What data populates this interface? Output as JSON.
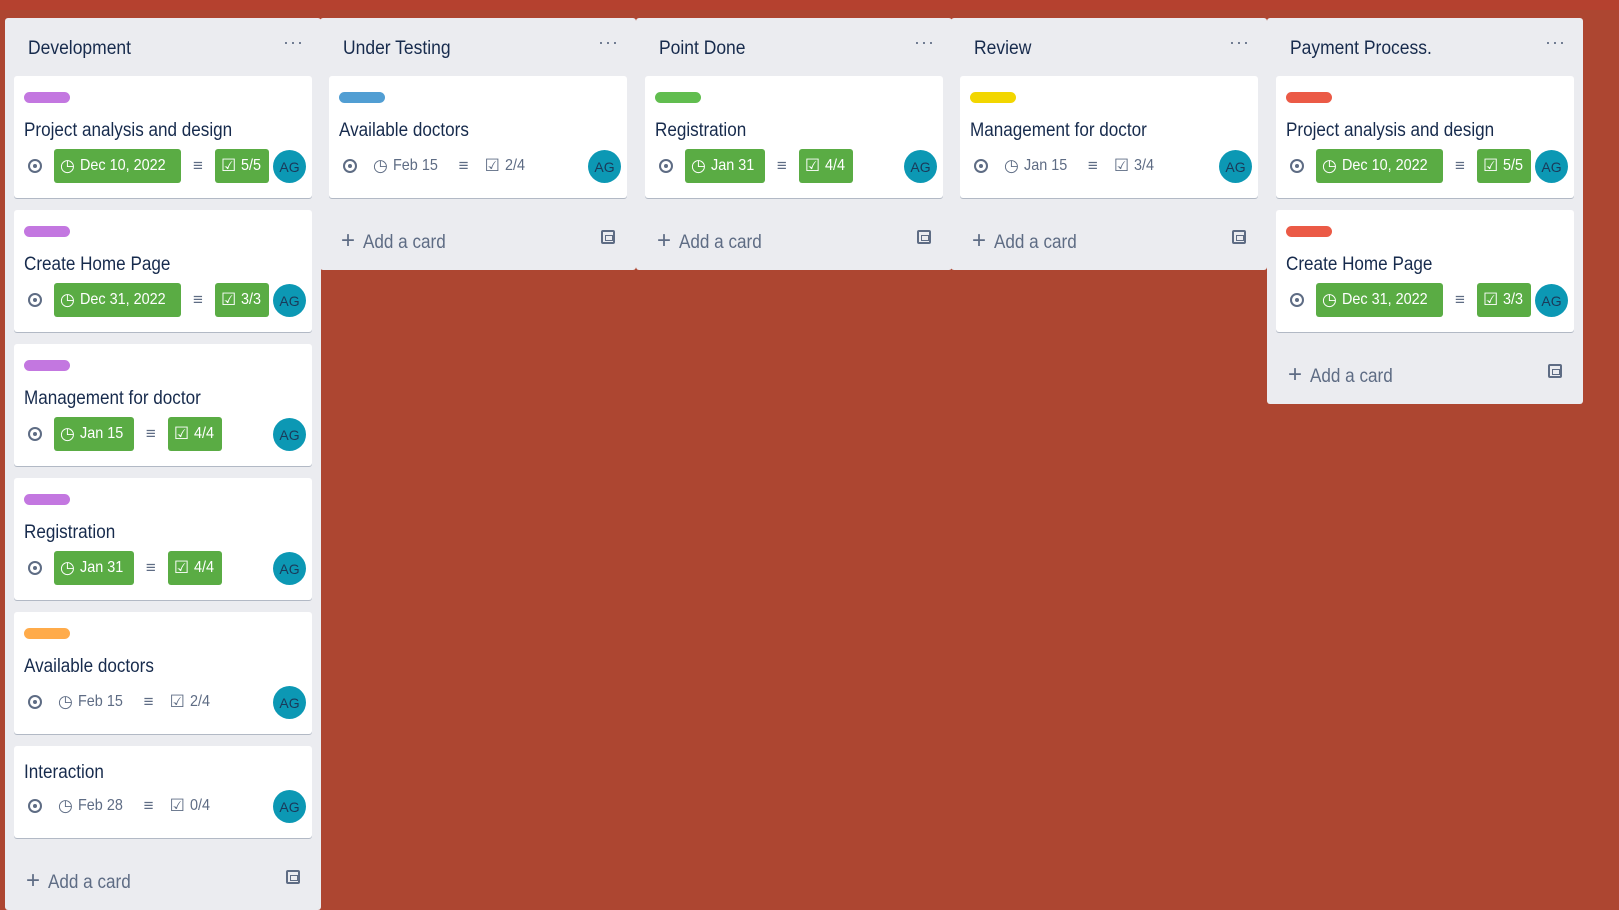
{
  "board": {
    "background_color": "#ad4631",
    "lists": [
      {
        "title": "Development",
        "menu_label": "···",
        "add_label": "Add a card",
        "cards": [
          {
            "label_color": "#c377e0",
            "title": "Project analysis and design",
            "due": "Dec 10, 2022",
            "due_complete": true,
            "checklist": "5/5",
            "checklist_complete": true,
            "member": "AG"
          },
          {
            "label_color": "#c377e0",
            "title": "Create Home Page",
            "due": "Dec 31, 2022",
            "due_complete": true,
            "checklist": "3/3",
            "checklist_complete": true,
            "member": "AG"
          },
          {
            "label_color": "#c377e0",
            "title": "Management for doctor",
            "due": "Jan 15",
            "due_complete": true,
            "checklist": "4/4",
            "checklist_complete": true,
            "member": "AG"
          },
          {
            "label_color": "#c377e0",
            "title": "Registration",
            "due": "Jan 31",
            "due_complete": true,
            "checklist": "4/4",
            "checklist_complete": true,
            "member": "AG"
          },
          {
            "label_color": "#ffab4a",
            "title": "Available doctors",
            "due": "Feb 15",
            "due_complete": false,
            "checklist": "2/4",
            "checklist_complete": false,
            "member": "AG"
          },
          {
            "label_color": null,
            "title": "Interaction",
            "due": "Feb 28",
            "due_complete": false,
            "checklist": "0/4",
            "checklist_complete": false,
            "member": "AG"
          }
        ]
      },
      {
        "title": "Under Testing",
        "menu_label": "···",
        "add_label": "Add a card",
        "cards": [
          {
            "label_color": "#519ed3",
            "title": "Available doctors",
            "due": "Feb 15",
            "due_complete": false,
            "checklist": "2/4",
            "checklist_complete": false,
            "member": "AG"
          }
        ]
      },
      {
        "title": "Point Done",
        "menu_label": "···",
        "add_label": "Add a card",
        "cards": [
          {
            "label_color": "#61bd4f",
            "title": "Registration",
            "due": "Jan 31",
            "due_complete": true,
            "checklist": "4/4",
            "checklist_complete": true,
            "member": "AG"
          }
        ]
      },
      {
        "title": "Review",
        "menu_label": "···",
        "add_label": "Add a card",
        "cards": [
          {
            "label_color": "#f2d600",
            "title": "Management for doctor",
            "due": "Jan 15",
            "due_complete": false,
            "checklist": "3/4",
            "checklist_complete": false,
            "member": "AG"
          }
        ]
      },
      {
        "title": "Payment Process.",
        "menu_label": "···",
        "add_label": "Add a card",
        "cards": [
          {
            "label_color": "#eb5a46",
            "title": "Project analysis and design",
            "due": "Dec 10, 2022",
            "due_complete": true,
            "checklist": "5/5",
            "checklist_complete": true,
            "member": "AG"
          },
          {
            "label_color": "#eb5a46",
            "title": "Create Home Page",
            "due": "Dec 31, 2022",
            "due_complete": true,
            "checklist": "3/3",
            "checklist_complete": true,
            "member": "AG"
          }
        ]
      }
    ]
  },
  "icons": {
    "watch": "eye-icon",
    "due": "clock-icon",
    "description": "description-icon",
    "checklist": "checklist-icon",
    "template": "card-template-icon",
    "add": "plus-icon"
  }
}
